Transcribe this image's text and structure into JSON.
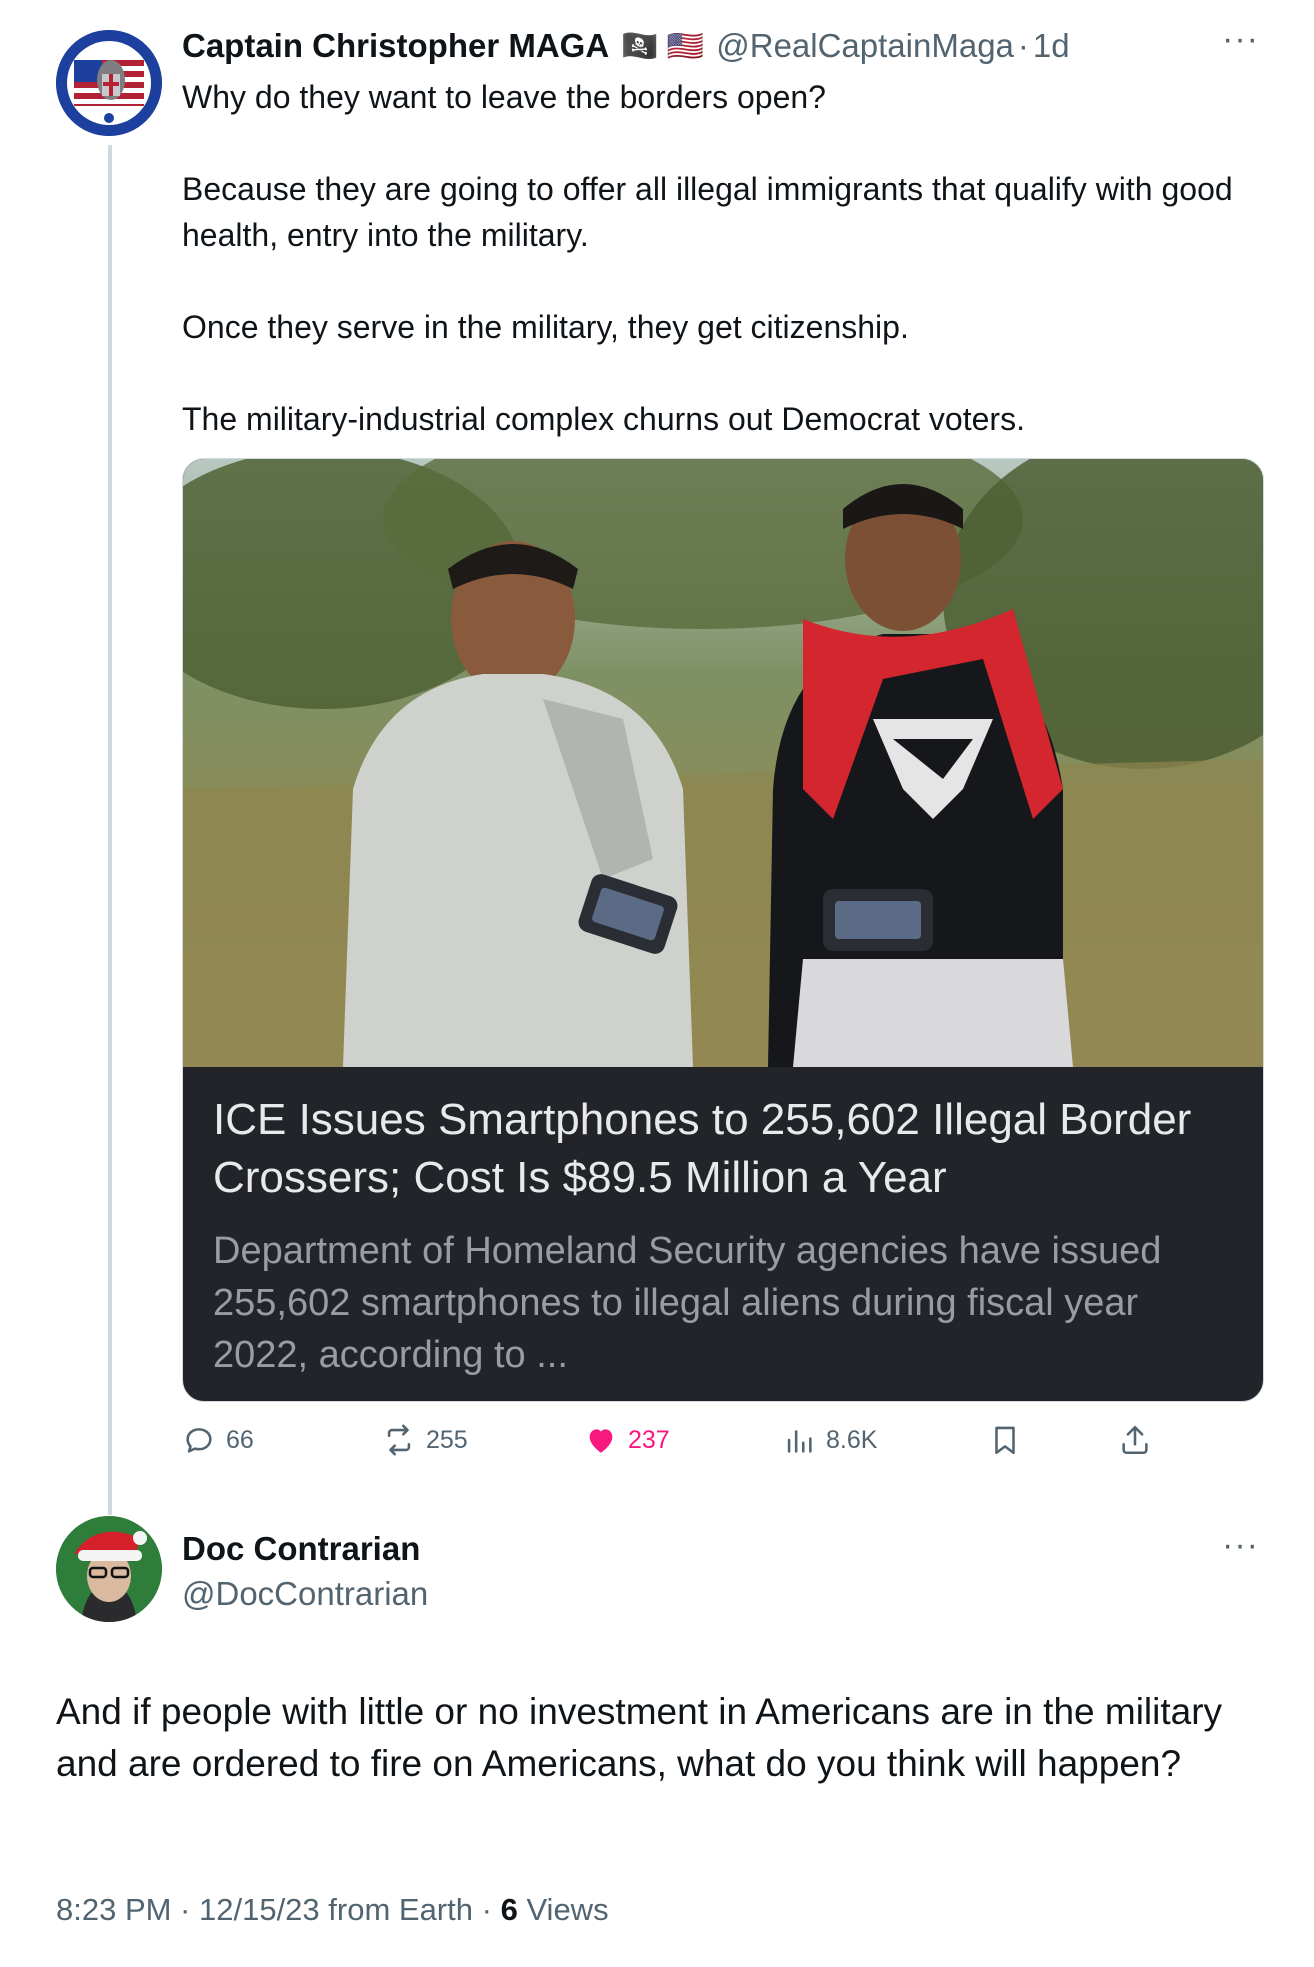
{
  "tweet": {
    "author_name": "Captain Christopher MAGA",
    "author_badges": "🏴‍☠️ 🇺🇸",
    "author_handle": "@RealCaptainMaga",
    "time_separator": "·",
    "time": "1d",
    "more_label": "···",
    "paragraphs": [
      "Why do they want to leave the borders open?",
      "Because they are going to offer all illegal immigrants that qualify with good health, entry into the military.",
      "Once they serve in the military, they get citizenship.",
      "The military-industrial complex churns out Democrat voters."
    ],
    "card": {
      "title": "ICE Issues Smartphones to 255,602 Illegal Border Crossers; Cost Is $89.5 Million a Year",
      "description": "Department of Homeland Security agencies have issued 255,602 smartphones to illegal aliens during fiscal year 2022, according to ..."
    },
    "actions": {
      "replies": "66",
      "reposts": "255",
      "likes": "237",
      "views": "8.6K"
    }
  },
  "reply": {
    "author_name": "Doc Contrarian",
    "author_handle": "@DocContrarian",
    "more_label": "···",
    "text": "And if people with little or no investment in Americans are in the military and are ordered to fire on Americans, what do you think will happen?",
    "timestamp": "8:23 PM · 12/15/23 from Earth ·",
    "views_count": "6",
    "views_label": "Views"
  },
  "colors": {
    "text_primary": "#0f1419",
    "text_secondary": "#536471",
    "like_pink": "#f91880",
    "card_dark": "#232429",
    "thread_line": "#cfd9de"
  }
}
